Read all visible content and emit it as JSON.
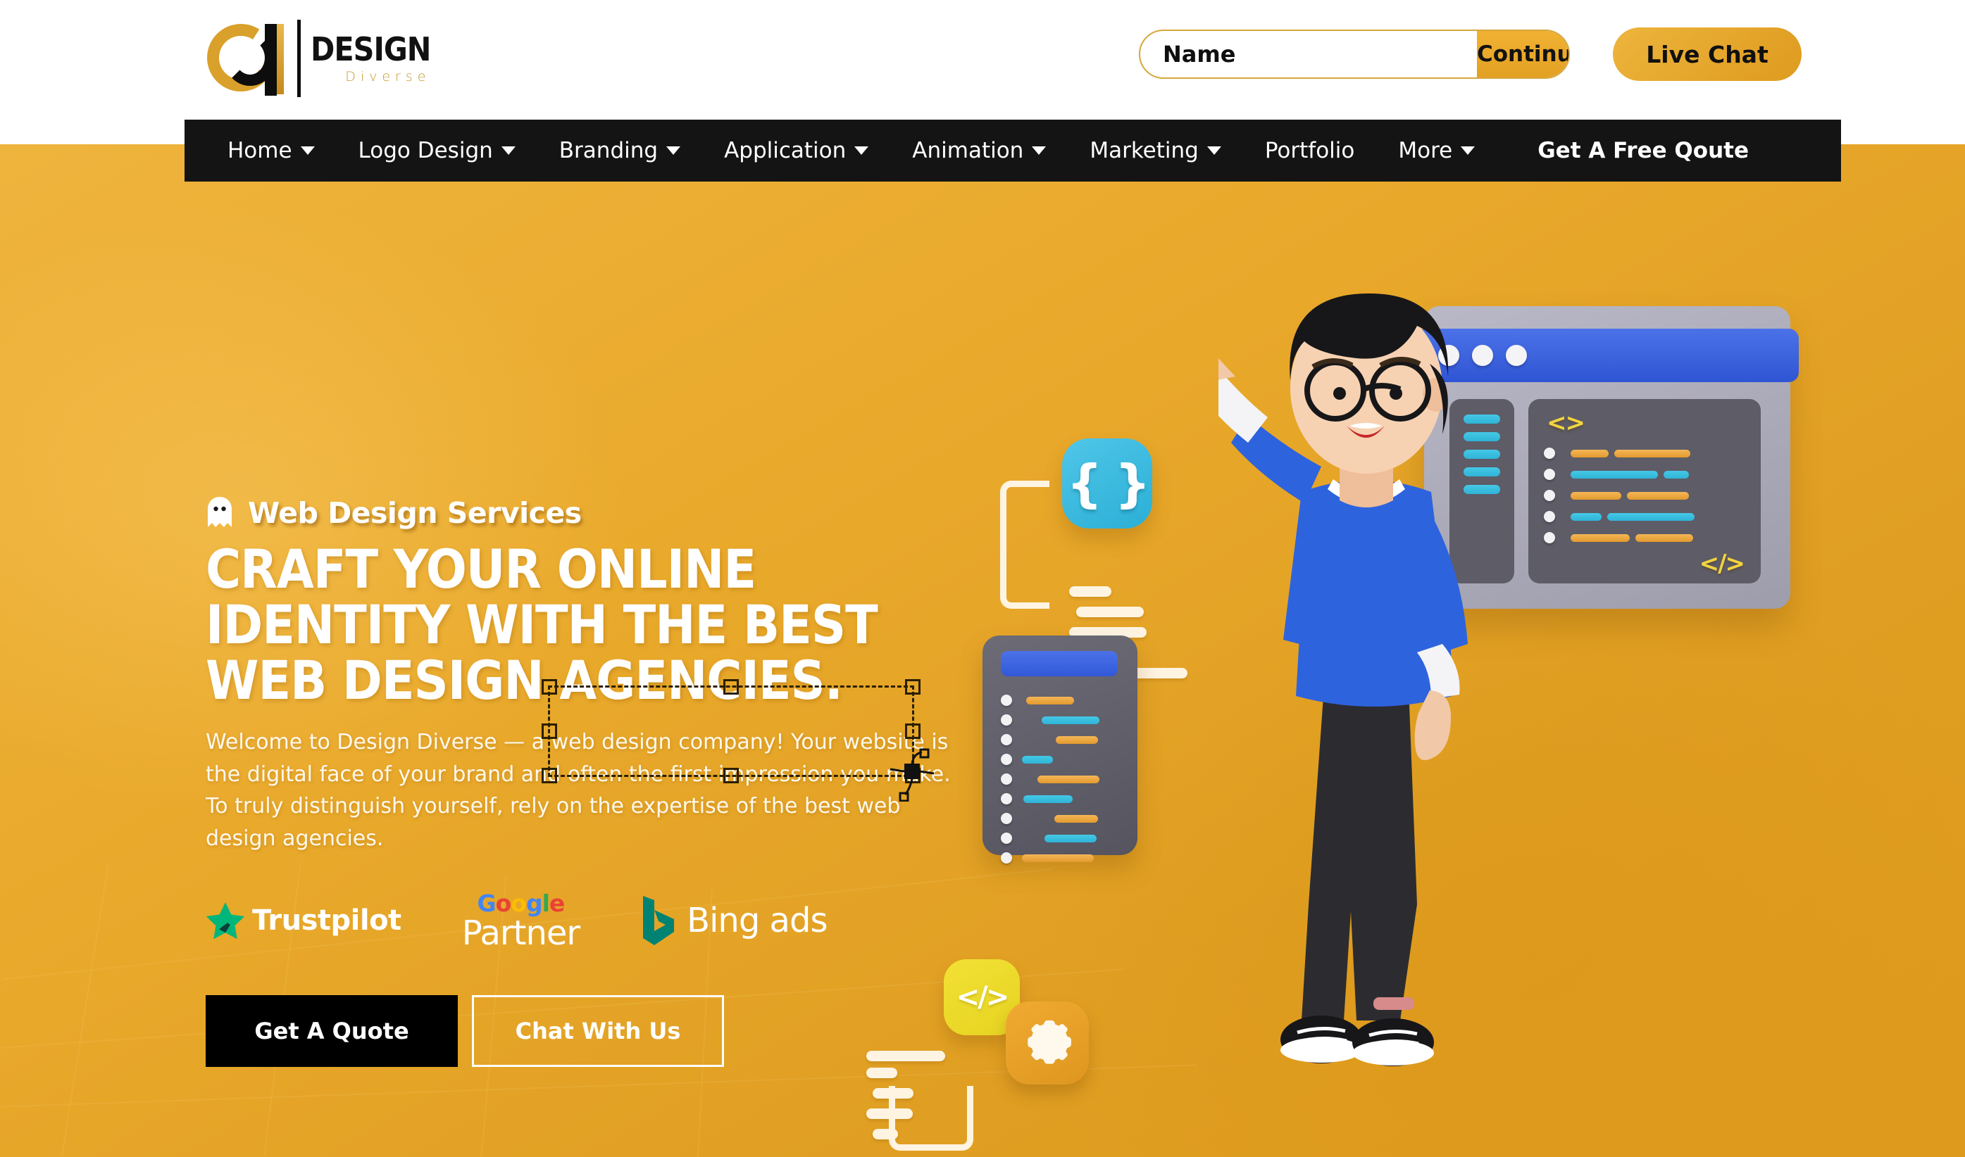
{
  "brand": {
    "logo_title": "DESIGN",
    "logo_subtitle": "Diverse",
    "logo_monogram": "d"
  },
  "header": {
    "name_input_placeholder": "Name",
    "name_input_value": "",
    "continue_label": "Continue",
    "live_chat_label": "Live Chat",
    "accent_color": "#E9A92B",
    "button_gradient_from": "#F1B132",
    "button_gradient_to": "#DE9B1F"
  },
  "nav": {
    "background_color": "#141414",
    "items": [
      {
        "label": "Home",
        "has_dropdown": true
      },
      {
        "label": "Logo Design",
        "has_dropdown": true
      },
      {
        "label": "Branding",
        "has_dropdown": true
      },
      {
        "label": "Application",
        "has_dropdown": true
      },
      {
        "label": "Animation",
        "has_dropdown": true
      },
      {
        "label": "Marketing",
        "has_dropdown": true
      },
      {
        "label": "Portfolio",
        "has_dropdown": false
      },
      {
        "label": "More",
        "has_dropdown": true
      }
    ],
    "cta_label": "Get A Free Qoute"
  },
  "hero": {
    "eyebrow": "Web Design Services",
    "eyebrow_icon": "ghost-icon",
    "heading_lines": [
      "CRAFT YOUR ONLINE",
      "IDENTITY WITH THE BEST",
      "WEB DESIGN AGENCIES."
    ],
    "paragraph": "Welcome to Design Diverse — a web design company! Your website is the digital face of your brand and often the first impression you make. To truly distinguish yourself, rely on the expertise of the best web design agencies.",
    "background_color": "#E9A92B",
    "text_color": "#FFFFFF",
    "badges": [
      {
        "name": "Trustpilot",
        "label": "Trustpilot",
        "icon": "star-icon",
        "icon_color": "#00B67A"
      },
      {
        "name": "Google Partner",
        "label_top": "Google",
        "label_bottom": "Partner",
        "letters": [
          "G",
          "o",
          "o",
          "g",
          "l",
          "e"
        ]
      },
      {
        "name": "Bing ads",
        "label": "Bing ads",
        "icon": "bing-logo-icon",
        "icon_color": "#008373"
      }
    ],
    "cta_primary": "Get A Quote",
    "cta_secondary": "Chat With Us"
  },
  "illustration": {
    "name": "web-developer-3d-illustration",
    "code_brace_glyph": "{ }",
    "code_tag_open": "<>",
    "code_tag_close": "</>",
    "code_tag_yellow": "</>",
    "gear_icon": "gear-icon",
    "window_dots": 3
  },
  "overlay": {
    "selection_handles": 8,
    "cursor_icon": "pen-tool-cursor"
  }
}
